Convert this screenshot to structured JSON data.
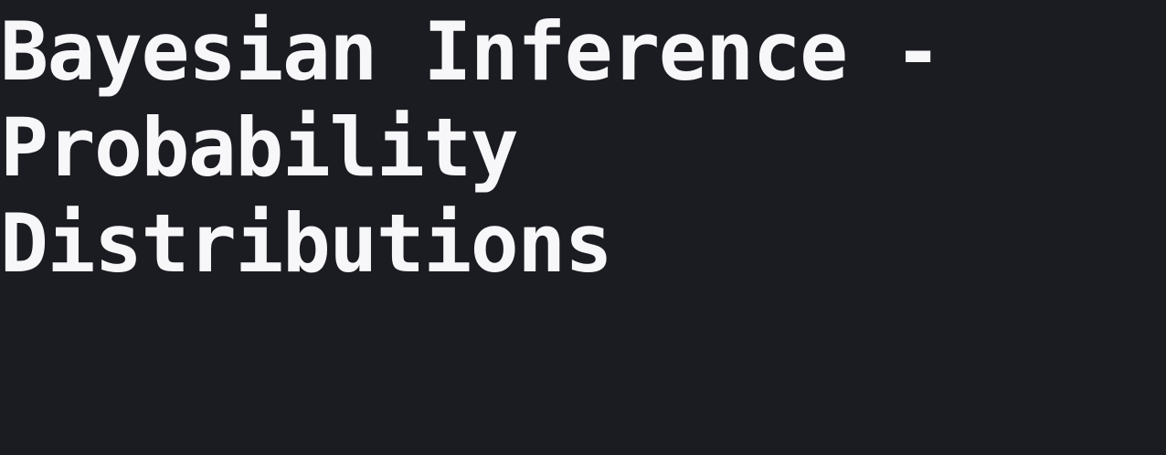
{
  "heading": {
    "lines": [
      "Bayesian Inference -",
      "Probability",
      "Distributions"
    ]
  },
  "colors": {
    "background": "#1b1c21",
    "text": "#f7f7fa"
  }
}
